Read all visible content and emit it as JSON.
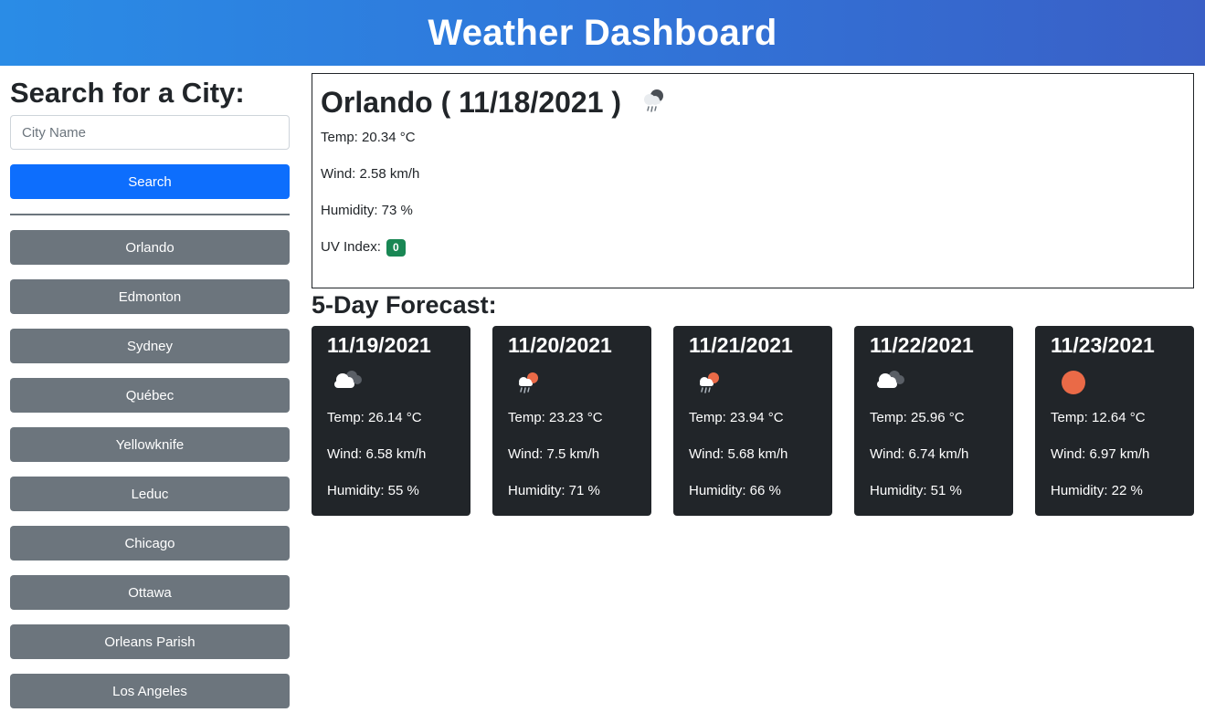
{
  "header": {
    "title": "Weather Dashboard"
  },
  "sidebar": {
    "heading": "Search for a City:",
    "input_placeholder": "City Name",
    "input_value": "",
    "search_label": "Search",
    "history": [
      "Orlando",
      "Edmonton",
      "Sydney",
      "Québec",
      "Yellowknife",
      "Leduc",
      "Chicago",
      "Ottawa",
      "Orleans Parish",
      "Los Angeles"
    ]
  },
  "current": {
    "title": "Orlando ( 11/18/2021 )",
    "icon": "cloud-rain-icon",
    "temp": "Temp: 20.34 °C",
    "wind": "Wind: 2.58 km/h",
    "humidity": "Humidity: 73 %",
    "uv_label": "UV Index:",
    "uv_value": "0",
    "uv_color": "#198754"
  },
  "forecast": {
    "heading": "5-Day Forecast:",
    "days": [
      {
        "date": "11/19/2021",
        "icon": "cloudy-icon",
        "temp": "Temp: 26.14 °C",
        "wind": "Wind: 6.58 km/h",
        "humidity": "Humidity: 55 %"
      },
      {
        "date": "11/20/2021",
        "icon": "sun-rain-icon",
        "temp": "Temp: 23.23 °C",
        "wind": "Wind: 7.5 km/h",
        "humidity": "Humidity: 71 %"
      },
      {
        "date": "11/21/2021",
        "icon": "sun-rain-icon",
        "temp": "Temp: 23.94 °C",
        "wind": "Wind: 5.68 km/h",
        "humidity": "Humidity: 66 %"
      },
      {
        "date": "11/22/2021",
        "icon": "cloudy-icon",
        "temp": "Temp: 25.96 °C",
        "wind": "Wind: 6.74 km/h",
        "humidity": "Humidity: 51 %"
      },
      {
        "date": "11/23/2021",
        "icon": "sun-icon",
        "temp": "Temp: 12.64 °C",
        "wind": "Wind: 6.97 km/h",
        "humidity": "Humidity: 22 %"
      }
    ]
  },
  "colors": {
    "header_start": "#2a8ce6",
    "header_end": "#3a5fc6",
    "primary": "#0d6efd",
    "secondary": "#6c757d",
    "card_dark": "#212529",
    "sun": "#ea6a47"
  }
}
